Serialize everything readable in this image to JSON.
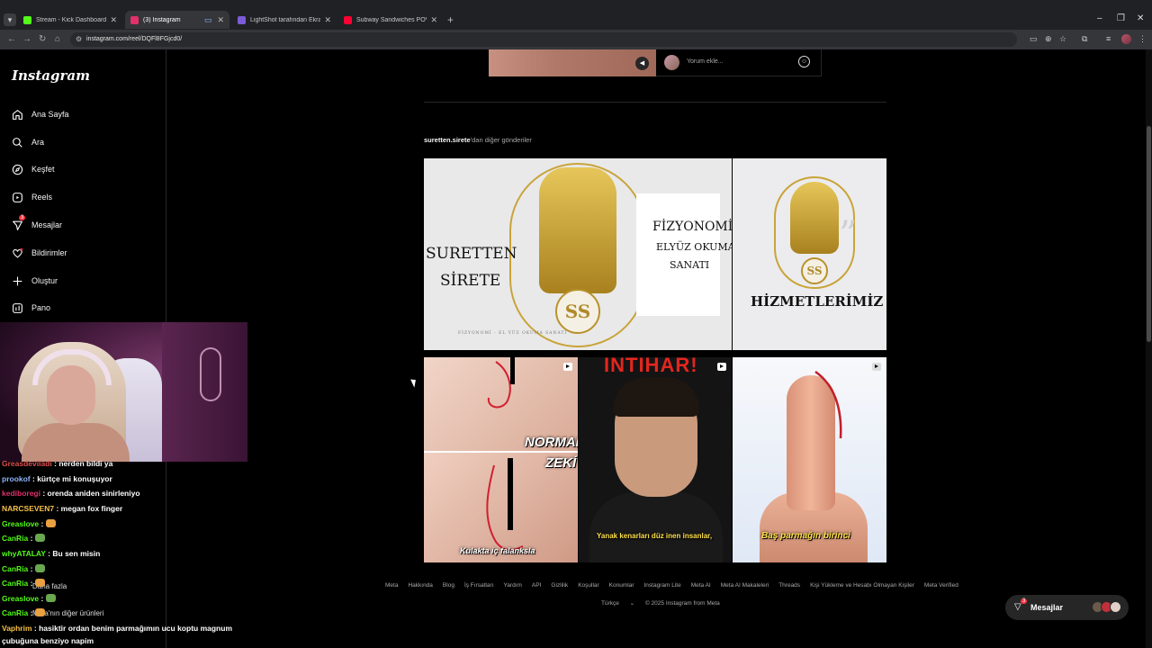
{
  "browser": {
    "tabs": [
      {
        "title": "Stream - Kick Dashboard",
        "color": "#53fc18"
      },
      {
        "title": "(3) Instagram",
        "color": "#e1306c"
      },
      {
        "title": "LightShot tarafından Ekran Gör...",
        "color": "#7b5cd6"
      },
      {
        "title": "Subway Sandwiches POV Worki...",
        "color": "#ff0033"
      }
    ],
    "url": "instagram.com/reel/DQFl8FGjcd0/"
  },
  "sidebar": {
    "logo": "Instagram",
    "items": [
      {
        "label": "Ana Sayfa",
        "icon": "home-icon"
      },
      {
        "label": "Ara",
        "icon": "search-icon"
      },
      {
        "label": "Keşfet",
        "icon": "compass-icon"
      },
      {
        "label": "Reels",
        "icon": "reels-icon"
      },
      {
        "label": "Mesajlar",
        "icon": "messenger-icon",
        "badge": "3"
      },
      {
        "label": "Bildirimler",
        "icon": "heart-icon"
      },
      {
        "label": "Oluştur",
        "icon": "plus-icon"
      },
      {
        "label": "Pano",
        "icon": "dashboard-icon"
      }
    ],
    "more_label": "Daha fazla",
    "meta_label": "Meta'nın diğer ürünleri"
  },
  "comment_bar": {
    "placeholder": "Yorum ekle..."
  },
  "more_posts": {
    "username": "suretten.sirete",
    "suffix": "'dan diğer gönderiler"
  },
  "posts": {
    "p1": {
      "left_title_1": "SURETTEN",
      "left_title_2": "SİRETE",
      "right_1": "FİZYONOMİ",
      "right_2": "ELYÜZ OKUMA",
      "right_3": "SANATI",
      "badge": "SS",
      "footer": "FİZYONOMİ - EL YÜZ OKUMA SANATI"
    },
    "p2": {
      "title": "HİZMETLERİMİZ",
      "badge": "SS"
    },
    "p3": {
      "overlay_1": "NORMAL",
      "overlay_2": "ZEKİ",
      "caption": "Kulakta iç falanksla"
    },
    "p4": {
      "headline": "İNTİHAR!",
      "caption": "Yanak kenarları düz inen insanlar,"
    },
    "p5": {
      "caption": "Baş parmağın birinci"
    }
  },
  "footer": {
    "links": [
      "Meta",
      "Hakkında",
      "Blog",
      "İş Fırsatları",
      "Yardım",
      "API",
      "Gizlilik",
      "Koşullar",
      "Konumlar",
      "Instagram Lite",
      "Meta AI",
      "Meta AI Makaleleri",
      "Threads",
      "Kişi Yükleme ve Hesabı Olmayan Kişiler",
      "Meta Verified"
    ],
    "language": "Türkçe",
    "copyright": "© 2025 Instagram from Meta"
  },
  "messages_pill": {
    "label": "Mesajlar",
    "badge": "3"
  },
  "chat": [
    {
      "user": "Greasdeviladi",
      "text": "nerden bildi ya",
      "color": "#e05050"
    },
    {
      "user": "prookof",
      "text": "kürtçe mi konuşuyor",
      "color": "#8ab4f8"
    },
    {
      "user": "kediboregi",
      "text": "orenda aniden sinirleniyo",
      "color": "#e0306c"
    },
    {
      "user": "NARCSEVEN7",
      "text": "megan fox finger",
      "color": "#f5c04a"
    },
    {
      "user": "Greaslove",
      "text": "",
      "color": "#53fc18"
    },
    {
      "user": "CanRia",
      "text": "",
      "color": "#53fc18"
    },
    {
      "user": "whyATALAY",
      "text": "Bu sen misin",
      "color": "#53fc18"
    },
    {
      "user": "CanRia",
      "text": "",
      "color": "#53fc18"
    },
    {
      "user": "CanRia",
      "text": "",
      "color": "#53fc18"
    },
    {
      "user": "Greaslove",
      "text": "",
      "color": "#53fc18"
    },
    {
      "user": "CanRia",
      "text": "",
      "color": "#53fc18"
    },
    {
      "user": "Vaphrim",
      "text": "hasiktir ordan benim parmağımın ucu koptu magnum",
      "color": "#f5c04a"
    },
    {
      "user": "",
      "text": "çubuğuna benziyo napim",
      "color": "#ffffff"
    }
  ]
}
